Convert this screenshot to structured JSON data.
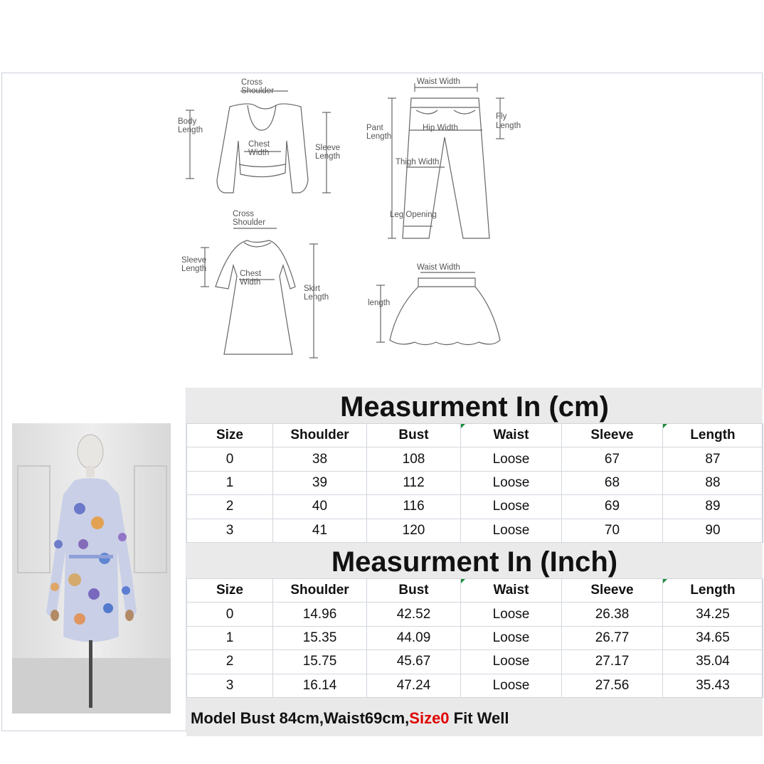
{
  "diagrams": {
    "top": {
      "cross_shoulder": [
        "Cross",
        "Shoulder"
      ],
      "body_length": [
        "Body",
        "Length"
      ],
      "chest_width": [
        "Chest",
        "Width"
      ],
      "sleeve_length": [
        "Sleeve",
        "Length"
      ]
    },
    "pants": {
      "waist_width": "Waist Width",
      "pant_length": [
        "Pant",
        "Length"
      ],
      "fly_length": [
        "Fly",
        "Length"
      ],
      "hip_width": "Hip Width",
      "thigh_width": "Thigh Width",
      "leg_opening": "Leg Opening"
    },
    "dress": {
      "cross_shoulder": [
        "Cross",
        "Shoulder"
      ],
      "sleeve_length": [
        "Sleeve",
        "Length"
      ],
      "chest_width": [
        "Chest",
        "Width"
      ],
      "skirt_length": [
        "Skirt",
        "Length"
      ]
    },
    "skirt": {
      "waist_width": "Waist Width",
      "length": "length"
    }
  },
  "cm_table": {
    "title": "Measurment In (cm)",
    "headers": [
      "Size",
      "Shoulder",
      "Bust",
      "Waist",
      "Sleeve",
      "Length"
    ],
    "rows": [
      [
        "0",
        "38",
        "108",
        "Loose",
        "67",
        "87"
      ],
      [
        "1",
        "39",
        "112",
        "Loose",
        "68",
        "88"
      ],
      [
        "2",
        "40",
        "116",
        "Loose",
        "69",
        "89"
      ],
      [
        "3",
        "41",
        "120",
        "Loose",
        "70",
        "90"
      ]
    ]
  },
  "inch_table": {
    "title": "Measurment In (Inch)",
    "headers": [
      "Size",
      "Shoulder",
      "Bust",
      "Waist",
      "Sleeve",
      "Length"
    ],
    "rows": [
      [
        "0",
        "14.96",
        "42.52",
        "Loose",
        "26.38",
        "34.25"
      ],
      [
        "1",
        "15.35",
        "44.09",
        "Loose",
        "26.77",
        "34.65"
      ],
      [
        "2",
        "15.75",
        "45.67",
        "Loose",
        "27.17",
        "35.04"
      ],
      [
        "3",
        "16.14",
        "47.24",
        "Loose",
        "27.56",
        "35.43"
      ]
    ]
  },
  "footer": {
    "prefix": "Model Bust 84cm,Waist69cm,",
    "highlight": "Size0",
    "suffix": " Fit Well"
  },
  "colors": {
    "highlight": "#e00000",
    "title_bg": "#eaeaea",
    "tick": "#1c8b3a"
  }
}
